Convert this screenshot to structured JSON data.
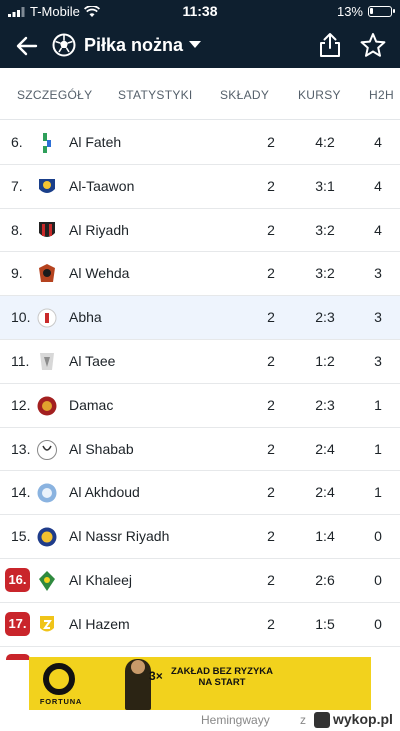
{
  "status_bar": {
    "carrier": "T-Mobile",
    "time": "11:38",
    "battery": "13%",
    "battery_level": 0.13
  },
  "nav": {
    "title": "Piłka nożna",
    "back_icon": "arrow-left-icon",
    "sport_icon": "soccer-ball-icon",
    "share_icon": "share-icon",
    "favorite_icon": "star-icon"
  },
  "tabs": [
    "SZCZEGÓŁY",
    "STATYSTYKI",
    "SKŁADY",
    "KURSY",
    "H2H"
  ],
  "table": {
    "rows": [
      {
        "rank": "6.",
        "team": "Al Fateh",
        "played": "2",
        "goals": "4:2",
        "points": "4",
        "relegation": false,
        "highlight": false
      },
      {
        "rank": "7.",
        "team": "Al-Taawon",
        "played": "2",
        "goals": "3:1",
        "points": "4",
        "relegation": false,
        "highlight": false
      },
      {
        "rank": "8.",
        "team": "Al Riyadh",
        "played": "2",
        "goals": "3:2",
        "points": "4",
        "relegation": false,
        "highlight": false
      },
      {
        "rank": "9.",
        "team": "Al Wehda",
        "played": "2",
        "goals": "3:2",
        "points": "3",
        "relegation": false,
        "highlight": false
      },
      {
        "rank": "10.",
        "team": "Abha",
        "played": "2",
        "goals": "2:3",
        "points": "3",
        "relegation": false,
        "highlight": true
      },
      {
        "rank": "11.",
        "team": "Al Taee",
        "played": "2",
        "goals": "1:2",
        "points": "3",
        "relegation": false,
        "highlight": false
      },
      {
        "rank": "12.",
        "team": "Damac",
        "played": "2",
        "goals": "2:3",
        "points": "1",
        "relegation": false,
        "highlight": false
      },
      {
        "rank": "13.",
        "team": "Al Shabab",
        "played": "2",
        "goals": "2:4",
        "points": "1",
        "relegation": false,
        "highlight": false
      },
      {
        "rank": "14.",
        "team": "Al Akhdoud",
        "played": "2",
        "goals": "2:4",
        "points": "1",
        "relegation": false,
        "highlight": false
      },
      {
        "rank": "15.",
        "team": "Al Nassr Riyadh",
        "played": "2",
        "goals": "1:4",
        "points": "0",
        "relegation": false,
        "highlight": false
      },
      {
        "rank": "16.",
        "team": "Al Khaleej",
        "played": "2",
        "goals": "2:6",
        "points": "0",
        "relegation": true,
        "highlight": false
      },
      {
        "rank": "17.",
        "team": "Al Hazem",
        "played": "2",
        "goals": "1:5",
        "points": "0",
        "relegation": true,
        "highlight": false
      }
    ]
  },
  "ad": {
    "brand": "FORTUNA",
    "multiplier": "3",
    "x": "×",
    "headline": "ZAKŁAD BEZ RYZYKA NA START"
  },
  "credit": {
    "user": "Hemingwayy",
    "z": "z",
    "site": "wykop.pl"
  },
  "colors": {
    "header_bg": "#0e1f2f",
    "relegation_red": "#c9252b",
    "highlight_row": "#eef4fd",
    "ad_yellow": "#f2d21d"
  }
}
